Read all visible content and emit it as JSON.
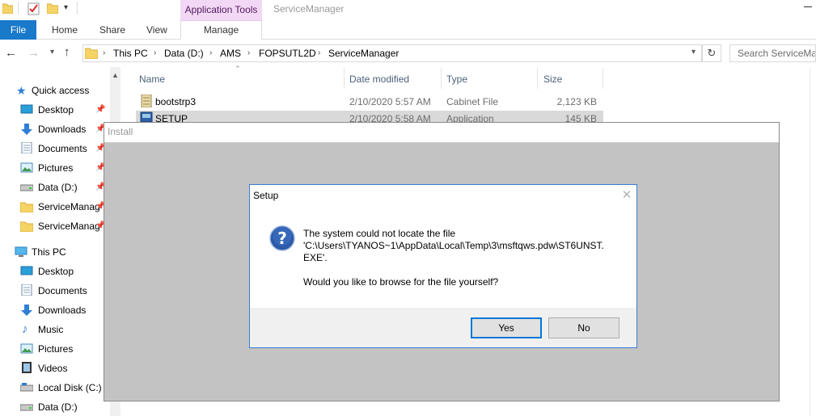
{
  "quick_access_toolbar": {
    "icons": [
      "folder-icon",
      "properties-checkbox-icon",
      "new-folder-icon",
      "dropdown-arrow-icon"
    ]
  },
  "ribbon": {
    "context_group": "Application Tools",
    "window_title": "ServiceManager",
    "tabs": {
      "file": "File",
      "home": "Home",
      "share": "Share",
      "view": "View",
      "manage": "Manage"
    }
  },
  "address_bar": {
    "crumbs": [
      "This PC",
      "Data (D:)",
      "AMS",
      "FOPSUTL2D",
      "ServiceManager"
    ],
    "search_placeholder": "Search ServiceMa"
  },
  "navigation_pane": {
    "quick_access": "Quick access",
    "quick_items": [
      {
        "label": "Desktop",
        "icon": "desktop-icon",
        "pinned": true
      },
      {
        "label": "Downloads",
        "icon": "downloads-icon",
        "pinned": true
      },
      {
        "label": "Documents",
        "icon": "documents-icon",
        "pinned": true
      },
      {
        "label": "Pictures",
        "icon": "pictures-icon",
        "pinned": true
      },
      {
        "label": "Data (D:)",
        "icon": "drive-icon",
        "pinned": true
      },
      {
        "label": "ServiceManag",
        "icon": "folder-icon",
        "pinned": true
      },
      {
        "label": "ServiceManag",
        "icon": "folder-icon",
        "pinned": true
      }
    ],
    "this_pc": "This PC",
    "pc_items": [
      {
        "label": "Desktop",
        "icon": "desktop-icon"
      },
      {
        "label": "Documents",
        "icon": "documents-icon"
      },
      {
        "label": "Downloads",
        "icon": "downloads-icon"
      },
      {
        "label": "Music",
        "icon": "music-icon"
      },
      {
        "label": "Pictures",
        "icon": "pictures-icon"
      },
      {
        "label": "Videos",
        "icon": "videos-icon"
      },
      {
        "label": "Local Disk (C:)",
        "icon": "local-disk-icon"
      },
      {
        "label": "Data (D:)",
        "icon": "drive-icon"
      }
    ]
  },
  "file_list": {
    "columns": [
      "Name",
      "Date modified",
      "Type",
      "Size"
    ],
    "rows": [
      {
        "name": "bootstrp3",
        "date": "2/10/2020 5:57 AM",
        "type": "Cabinet File",
        "size": "2,123 KB",
        "icon": "cabinet-file-icon"
      },
      {
        "name": "SETUP",
        "date": "2/10/2020 5:58 AM",
        "type": "Application",
        "size": "145 KB",
        "icon": "setup-application-icon"
      }
    ]
  },
  "install_window": {
    "title": "Install"
  },
  "setup_dialog": {
    "title": "Setup",
    "message_lines": [
      "The system could not locate the file",
      "'C:\\Users\\TYANOS~1\\AppData\\Local\\Temp\\3\\msftqws.pdw\\ST6UNST.",
      "EXE'."
    ],
    "question": "Would you like to browse for the file yourself?",
    "yes_label": "Yes",
    "no_label": "No",
    "close_glyph": "✕"
  },
  "colors": {
    "file_tab": "#1979ca",
    "context_tab": "#f3d8f6",
    "dialog_border": "#3a7bd5",
    "install_bg": "#c3c3c3",
    "header_text": "#4c607a"
  }
}
